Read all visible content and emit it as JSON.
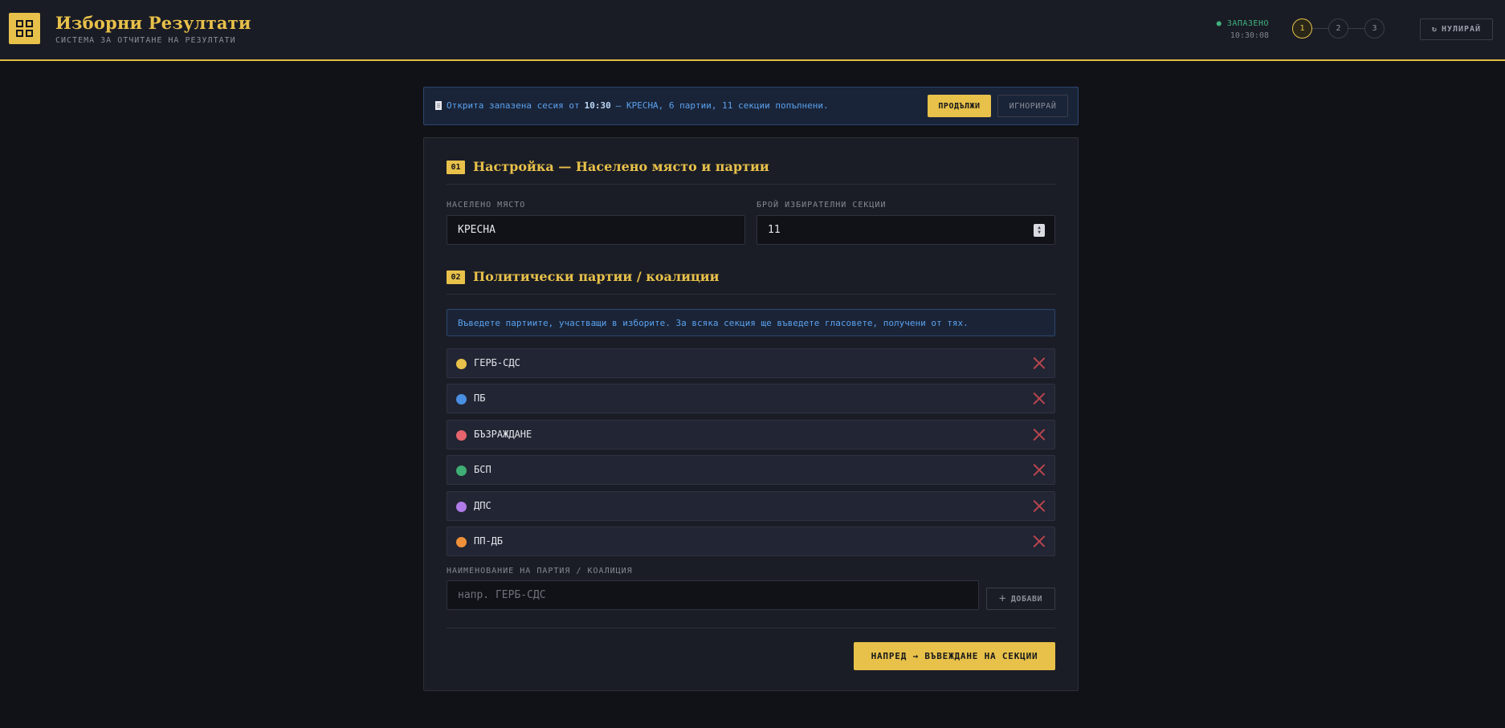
{
  "header": {
    "title": "Изборни Резултати",
    "subtitle": "СИСТЕМА ЗА ОТЧИТАНЕ НА РЕЗУЛТАТИ",
    "saved_label": "● ЗАПАЗЕНО",
    "saved_time": "10:30:08",
    "steps": [
      "1",
      "2",
      "3"
    ],
    "active_step": 1,
    "reset_icon": "↻",
    "reset_label": "НУЛИРАЙ",
    "accent_color": "#e8c14a"
  },
  "banner": {
    "icon": "document-icon",
    "text_before": "Открита запазена сесия от",
    "time": "10:30",
    "text_after": "— КРЕСНА, 6 партии, 11 секции попълнени.",
    "continue_label": "ПРОДЪЛЖИ",
    "ignore_label": "ИГНОРИРАЙ"
  },
  "setup": {
    "number": "01",
    "title": "Настройка — Населено място и партии",
    "place_label": "НАСЕЛЕНО МЯСТО",
    "place_value": "КРЕСНА",
    "sections_label": "БРОЙ ИЗБИРАТЕЛНИ СЕКЦИИ",
    "sections_value": "11"
  },
  "parties": {
    "number": "02",
    "title": "Политически партии / коалиции",
    "info": "Въведете партиите, участващи в изборите. За всяка секция ще въведете гласовете, получени от тях.",
    "items": [
      {
        "name": "ГЕРБ-СДС",
        "color": "#e8c14a"
      },
      {
        "name": "ПБ",
        "color": "#4a90e2"
      },
      {
        "name": "БЪЗРАЖДАНЕ",
        "color": "#e5646e"
      },
      {
        "name": "БСП",
        "color": "#3fae74"
      },
      {
        "name": "ДПС",
        "color": "#b07be8"
      },
      {
        "name": "ПП-ДБ",
        "color": "#f0913a"
      }
    ],
    "new_label": "НАИМЕНОВАНИЕ НА ПАРТИЯ / КОАЛИЦИЯ",
    "new_placeholder": "напр. ГЕРБ-СДС",
    "add_icon": "+",
    "add_label": "ДОБАВИ"
  },
  "footer": {
    "next_label": "НАПРЕД → ВЪВЕЖДАНЕ НА СЕКЦИИ"
  }
}
